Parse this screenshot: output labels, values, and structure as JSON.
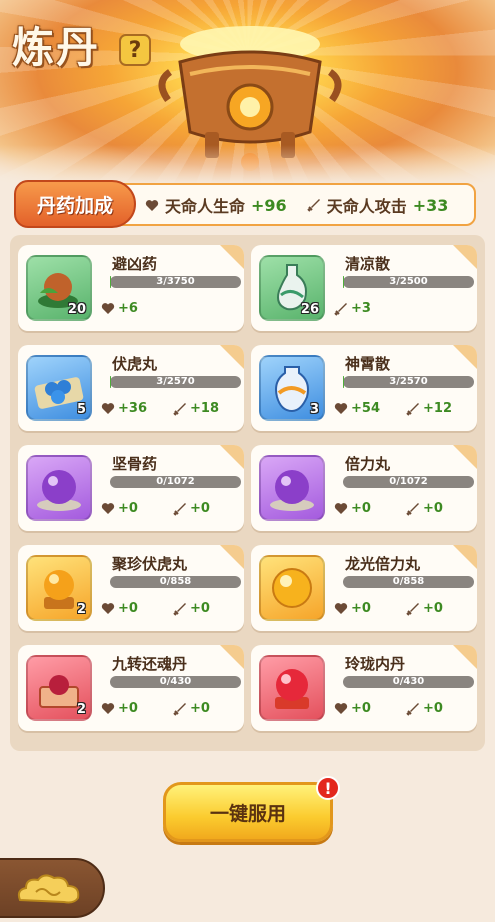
{
  "header": {
    "title": "炼丹",
    "help_label": "?"
  },
  "bonus": {
    "tag_label": "丹药加成",
    "hp_label": "天命人生命",
    "hp_value": "+96",
    "atk_label": "天命人攻击",
    "atk_value": "+33"
  },
  "items": [
    {
      "name": "避凶药",
      "progress_text": "3/3750",
      "progress": 0.0008,
      "count": "20",
      "hp": "+6",
      "atk": "",
      "color": "green",
      "icon": "seed-herb-icon"
    },
    {
      "name": "清凉散",
      "progress_text": "3/2500",
      "progress": 0.0012,
      "count": "26",
      "hp": "",
      "atk": "+3",
      "color": "green",
      "icon": "gourd-bottle-icon"
    },
    {
      "name": "伏虎丸",
      "progress_text": "3/2570",
      "progress": 0.0012,
      "count": "5",
      "hp": "+36",
      "atk": "+18",
      "color": "blue",
      "icon": "blue-pills-icon"
    },
    {
      "name": "神霄散",
      "progress_text": "3/2570",
      "progress": 0.0012,
      "count": "3",
      "hp": "+54",
      "atk": "+12",
      "color": "blue",
      "icon": "porcelain-vase-icon"
    },
    {
      "name": "坚骨药",
      "progress_text": "0/1072",
      "progress": 0,
      "count": "",
      "hp": "+0",
      "atk": "+0",
      "color": "purple",
      "icon": "purple-orb-icon"
    },
    {
      "name": "倍力丸",
      "progress_text": "0/1072",
      "progress": 0,
      "count": "",
      "hp": "+0",
      "atk": "+0",
      "color": "purple",
      "icon": "purple-orb-icon"
    },
    {
      "name": "聚珍伏虎丸",
      "progress_text": "0/858",
      "progress": 0,
      "count": "2",
      "hp": "+0",
      "atk": "+0",
      "color": "orange",
      "icon": "gold-orb-stand-icon"
    },
    {
      "name": "龙光倍力丸",
      "progress_text": "0/858",
      "progress": 0,
      "count": "",
      "hp": "+0",
      "atk": "+0",
      "color": "orange",
      "icon": "gold-orb-icon"
    },
    {
      "name": "九转还魂丹",
      "progress_text": "0/430",
      "progress": 0,
      "count": "2",
      "hp": "+0",
      "atk": "+0",
      "color": "red",
      "icon": "red-pill-box-icon"
    },
    {
      "name": "玲珑内丹",
      "progress_text": "0/430",
      "progress": 0,
      "count": "",
      "hp": "+0",
      "atk": "+0",
      "color": "red",
      "icon": "red-orb-icon"
    }
  ],
  "footer": {
    "use_all_label": "一键服用",
    "alert_label": "!"
  }
}
